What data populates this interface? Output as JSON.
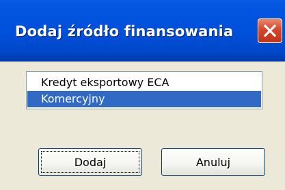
{
  "window": {
    "title": "Dodaj źródło finansowania",
    "close_icon": "close-icon",
    "title_color": "#0050dc",
    "close_color": "#d4462a"
  },
  "list": {
    "items": [
      {
        "label": "Kredyt eksportowy ECA",
        "selected": false
      },
      {
        "label": "Komercyjny",
        "selected": true
      }
    ],
    "selection_color": "#316ac5"
  },
  "buttons": {
    "ok_label": "Dodaj",
    "cancel_label": "Anuluj"
  }
}
